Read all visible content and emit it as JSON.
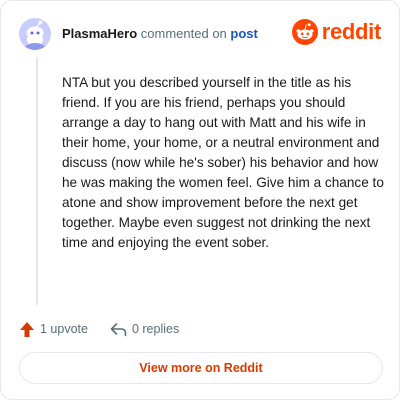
{
  "comment": {
    "username": "PlasmaHero",
    "action_text": "commented on",
    "target_link": "post",
    "avatar_icon": "snoo-avatar-icon",
    "body": "NTA but you described yourself in the title as his friend. If you are his friend, perhaps you should arrange a day to hang out with Matt and his wife in their home, your home, or a neutral environment and discuss (now while he's sober) his behavior and how he was making the women feel. Give him a chance to atone and show improvement before the next get together. Maybe even suggest not drinking the next time and enjoying the event sober.",
    "upvotes_label": "1 upvote",
    "replies_label": "0 replies"
  },
  "brand": {
    "name": "reddit",
    "icon": "reddit-logo-icon",
    "color": "#ff4500"
  },
  "footer": {
    "view_more_label": "View more on Reddit"
  }
}
